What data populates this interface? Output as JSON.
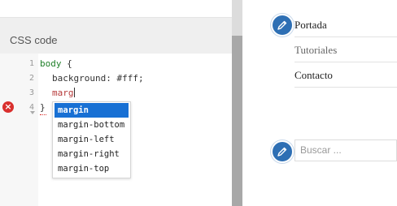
{
  "editor": {
    "header_title": "CSS code",
    "line_numbers": [
      "1",
      "2",
      "3",
      "4"
    ],
    "lines": {
      "l1_selector": "body",
      "l1_brace": " {",
      "l2_prop": "background",
      "l2_sep": ": ",
      "l2_value": "#fff",
      "l2_end": ";",
      "l3_typing": "marg",
      "l4_brace": "}"
    },
    "error_icon_glyph": "×",
    "autocomplete": [
      "margin",
      "margin-bottom",
      "margin-left",
      "margin-right",
      "margin-top"
    ]
  },
  "preview": {
    "nav_items": [
      "Portada",
      "Tutoriales",
      "Contacto"
    ],
    "search_placeholder": "Buscar ..."
  },
  "colors": {
    "selected_suggestion": "#1870d4",
    "error": "#d9302e",
    "edit_badge": "#2e6fb4",
    "selector_text": "#1f7f28"
  },
  "icons": {
    "nav_edit": "pencil-icon",
    "search_edit": "pencil-icon",
    "error": "error-icon"
  }
}
